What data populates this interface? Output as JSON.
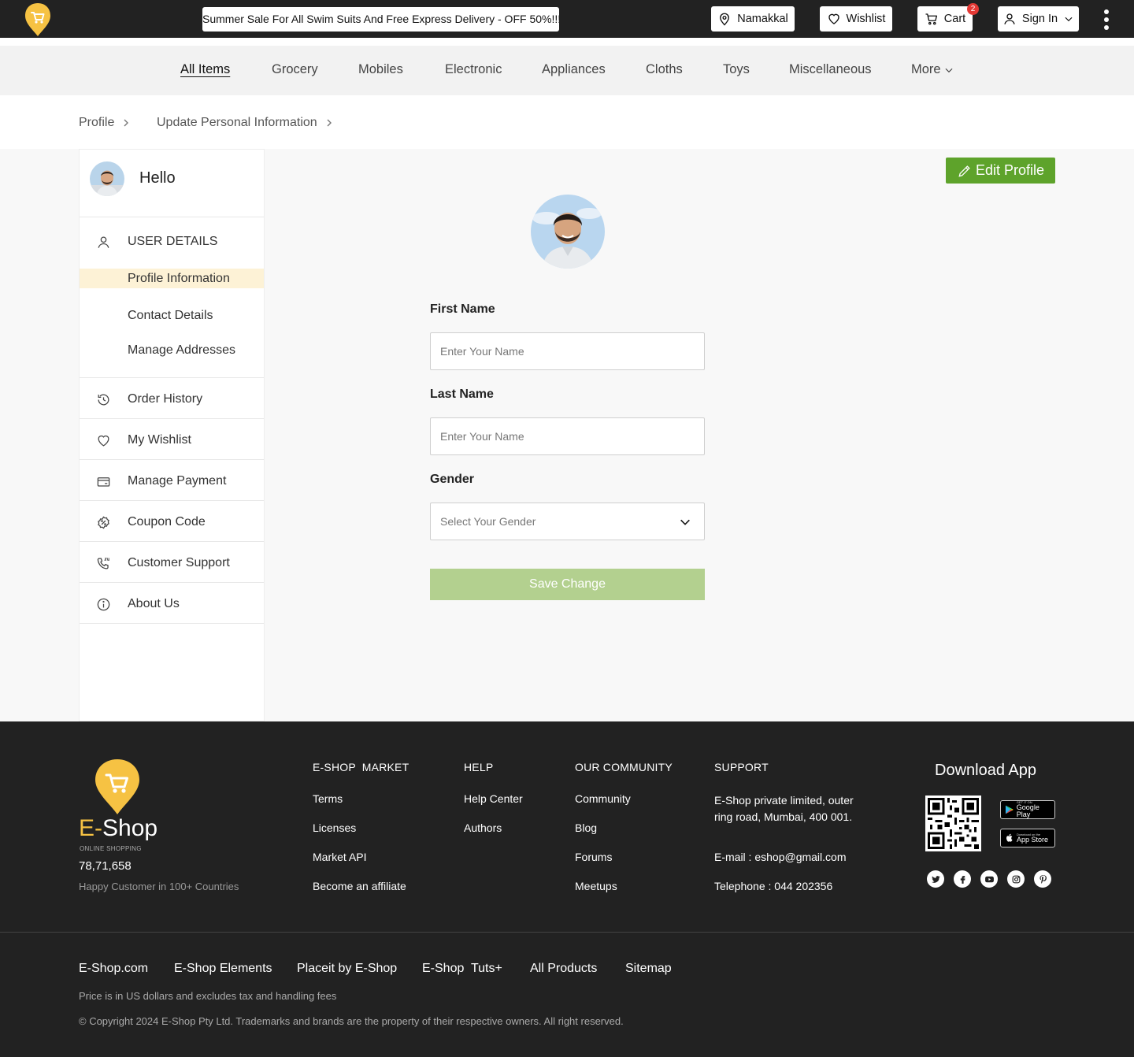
{
  "topbar": {
    "promo": "Summer Sale For All Swim Suits And Free Express Delivery - OFF 50%!!!",
    "location": "Namakkal",
    "wishlist": "Wishlist",
    "cart": "Cart",
    "cart_count": "2",
    "sign_in": "Sign In",
    "accent": "#f6c243"
  },
  "categories": [
    "All Items",
    "Grocery",
    "Mobiles",
    "Electronic",
    "Appliances",
    "Cloths",
    "Toys",
    "Miscellaneous",
    "More"
  ],
  "breadcrumb": [
    "Profile",
    "Update Personal Information"
  ],
  "sidebar": {
    "greeting": "Hello",
    "section": "USER DETAILS",
    "sub_items": [
      "Profile Information",
      "Contact Details",
      "Manage Addresses"
    ],
    "items": [
      {
        "label": "Order History",
        "icon": "history-icon"
      },
      {
        "label": "My Wishlist",
        "icon": "heart-icon"
      },
      {
        "label": "Manage Payment",
        "icon": "card-icon"
      },
      {
        "label": "Coupon Code",
        "icon": "coupon-icon"
      },
      {
        "label": "Customer Support",
        "icon": "phone-24-icon"
      },
      {
        "label": "About Us",
        "icon": "info-icon"
      }
    ]
  },
  "form": {
    "edit_profile": "Edit Profile",
    "first_name_label": "First Name",
    "first_name_placeholder": "Enter Your Name",
    "last_name_label": "Last Name",
    "last_name_placeholder": "Enter Your Name",
    "gender_label": "Gender",
    "gender_placeholder": "Select Your Gender",
    "save": "Save Change",
    "save_color": "#b3d08f",
    "edit_color": "#5ea32b"
  },
  "footer": {
    "brand_e": "E-",
    "brand_rest": "Shop",
    "tagline": "ONLINE SHOPPING",
    "customers": "78,71,658",
    "customers_note": "Happy Customer in 100+ Countries",
    "columns": [
      {
        "title": "E-SHOP  MARKET",
        "links": [
          "Terms",
          "Licenses",
          "Market API",
          "Become an affiliate"
        ]
      },
      {
        "title": "HELP",
        "links": [
          "Help Center",
          "Authors"
        ]
      },
      {
        "title": "OUR COMMUNITY",
        "links": [
          "Community",
          "Blog",
          "Forums",
          "Meetups"
        ]
      },
      {
        "title": "SUPPORT",
        "links": []
      }
    ],
    "support_address": "E-Shop private limited, outer ring road, Mumbai, 400 001.",
    "support_email": "E-mail : eshop@gmail.com",
    "support_phone": "Telephone : 044 202356",
    "download_title": "Download App",
    "google_play_small": "GET IT ON",
    "google_play": "Google Play",
    "app_store_small": "Download on the",
    "app_store": "App Store",
    "socials": [
      "twitter-icon",
      "facebook-icon",
      "youtube-icon",
      "instagram-icon",
      "pinterest-icon"
    ],
    "bottom_links": [
      "E-Shop.com",
      "E-Shop Elements",
      "Placeit by E-Shop",
      "E-Shop  Tuts+",
      "All Products",
      "Sitemap"
    ],
    "price_note": "Price is in US dollars and excludes tax and handling fees",
    "copyright": "© Copyright 2024 E-Shop Pty Ltd. Trademarks and brands are the property of their respective owners. All right reserved."
  }
}
